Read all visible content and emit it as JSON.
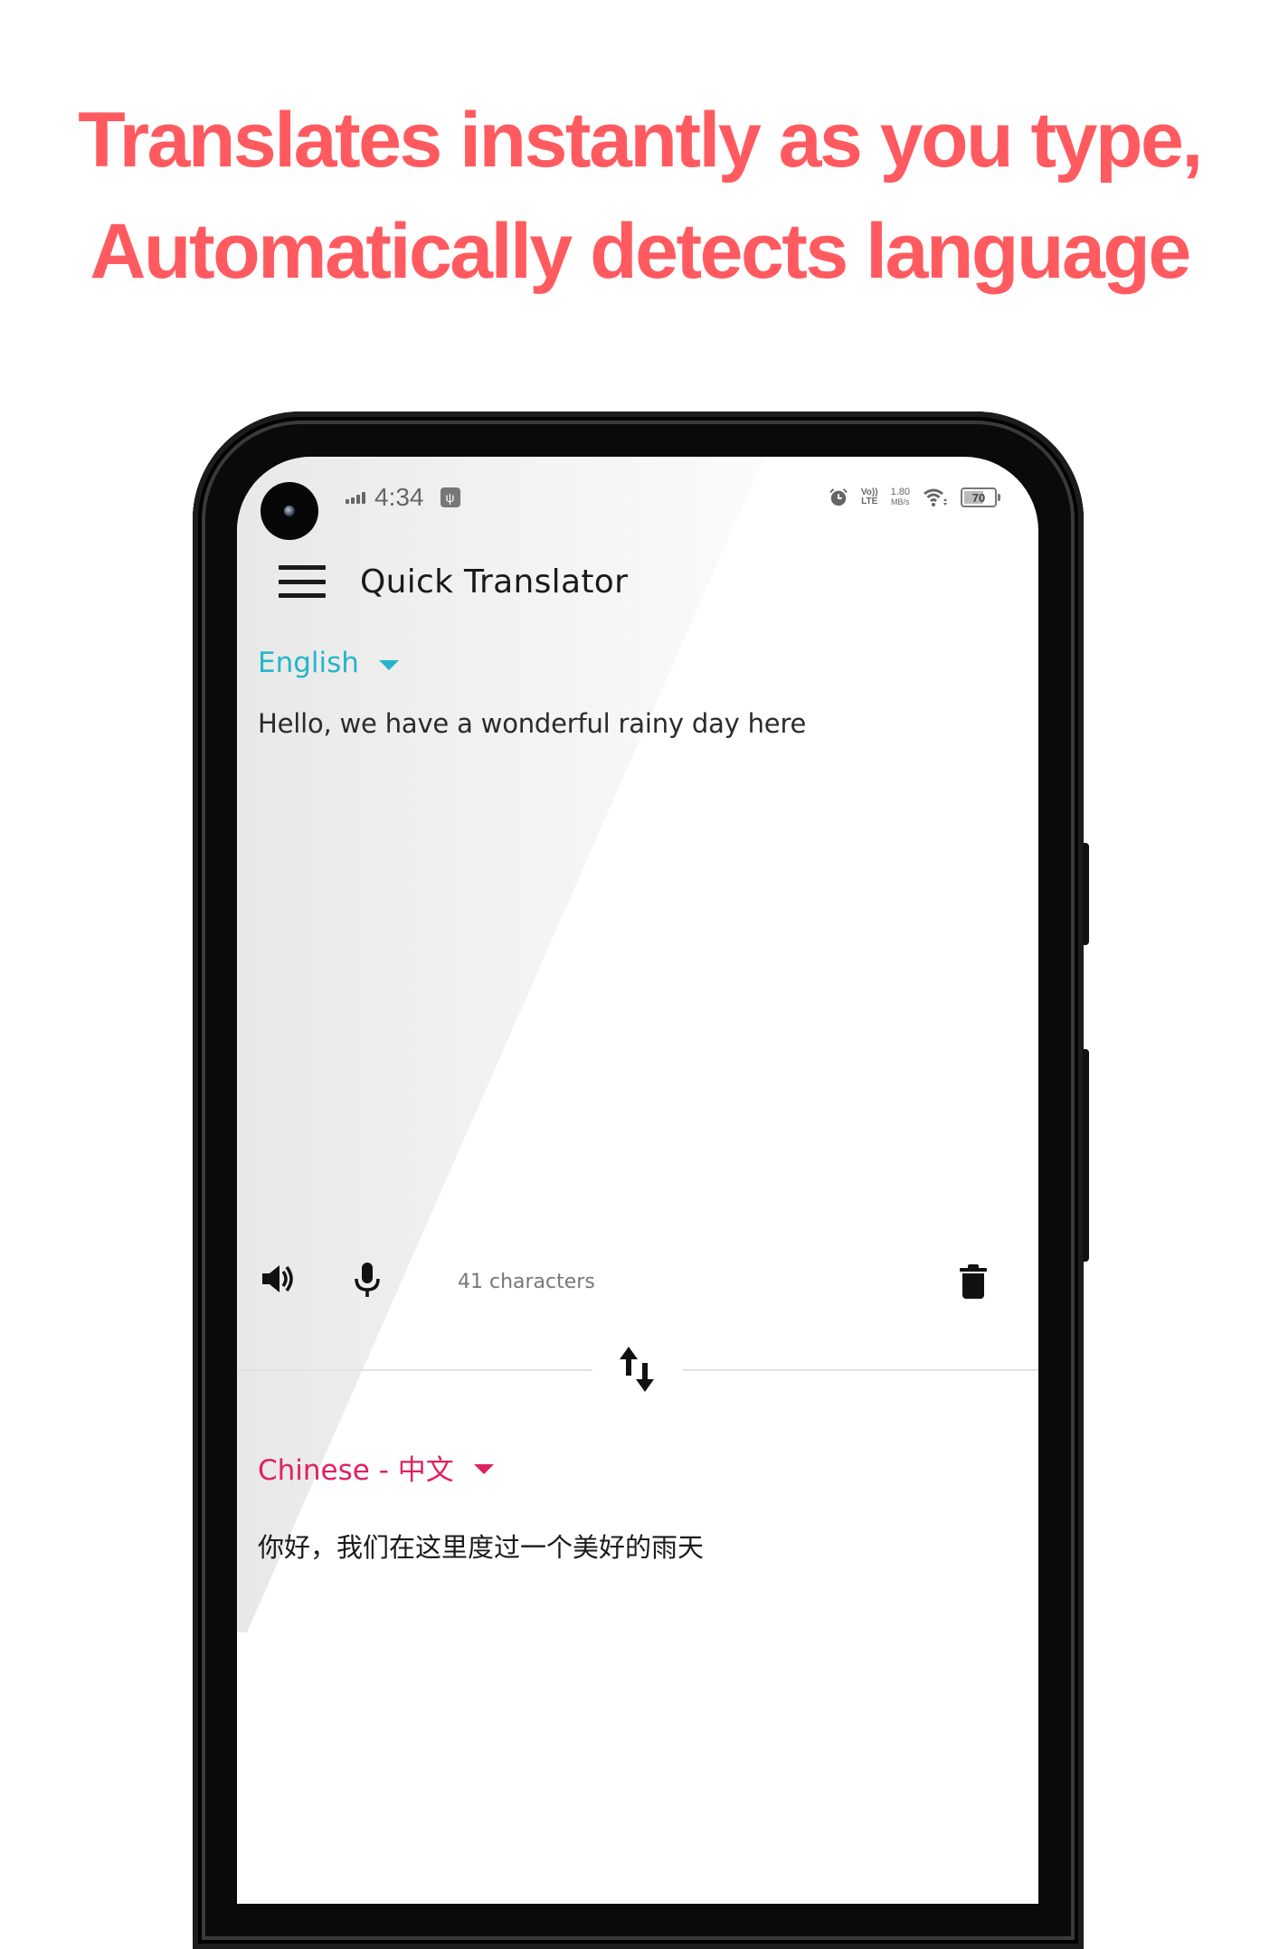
{
  "headline": {
    "line1": "Translates instantly as you type,",
    "line2": "Automatically detects language",
    "color": "#FF5A5F"
  },
  "status_bar": {
    "time": "4:34",
    "usb_icon": "usb-icon",
    "volte_top": "Vo))",
    "volte_bottom": "LTE",
    "speed_value": "1.80",
    "speed_unit": "MB/s",
    "battery_level": "70",
    "battery_percent": 70
  },
  "app": {
    "title": "Quick Translator",
    "menu_icon": "hamburger-menu-icon"
  },
  "source": {
    "language": "English",
    "language_color": "#26B5C8",
    "text": "Hello, we have a wonderful rainy day here",
    "char_count_label": "41 characters"
  },
  "toolbar": {
    "speak_icon": "speaker-icon",
    "mic_icon": "microphone-icon",
    "delete_icon": "trash-icon",
    "swap_icon": "swap-languages-icon"
  },
  "target": {
    "language": "Chinese - 中文",
    "language_color": "#E0215F",
    "text": "你好，我们在这里度过一个美好的雨天"
  }
}
